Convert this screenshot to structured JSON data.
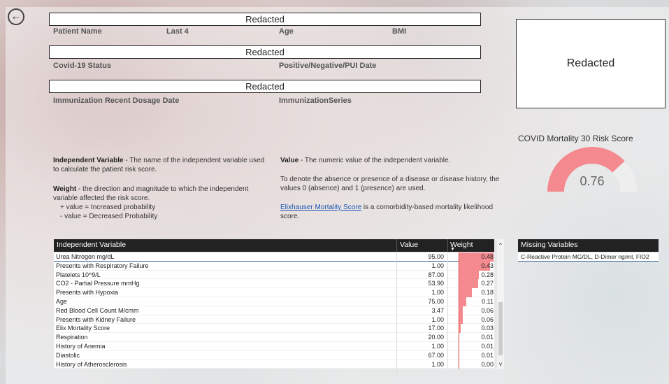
{
  "header": {
    "redacted_1": "Redacted",
    "redacted_2": "Redacted",
    "redacted_3": "Redacted",
    "labels": {
      "patient_name": "Patient Name",
      "last4": "Last 4",
      "age": "Age",
      "bmi": "BMI",
      "covid_status": "Covid-19 Status",
      "positive_date": "Positive/Negative/PUI Date",
      "immunization_date": "Immunization Recent Dosage Date",
      "immunization_series": "ImmunizationSeries"
    }
  },
  "photo": {
    "text": "Redacted"
  },
  "gauge": {
    "title": "COVID Mortality 30 Risk Score",
    "value_label": "0.76",
    "value": 0.76,
    "fill_color": "#f48a8f",
    "track_color": "#eeeeee"
  },
  "legend": {
    "iv_term": "Independent Variable",
    "iv_desc": " - The name of the independent variable used to calculate the patient risk score.",
    "weight_term": "Weight",
    "weight_desc": " - the direction and  magnitude to which the independent variable affected the risk score.",
    "weight_pos": "+ value = Increased probability",
    "weight_neg": "- value = Decreased Probability",
    "value_term": "Value",
    "value_desc": " - The numeric value of the independent  variable.",
    "binary_desc": "To denote the absence or presence of a disease or disease history, the values 0 (absence) and 1 (presence) are used.",
    "elix_link": "Elixhauser Mortality Score",
    "elix_desc": " is a comorbidity-based mortality likelihood score."
  },
  "table": {
    "headers": {
      "name": "Independent Variable",
      "value": "Value",
      "weight": "Weight"
    },
    "rows": [
      {
        "name": "Urea Nitrogen mg/dL",
        "value": "95.00",
        "weight": "0.48",
        "w": 0.48
      },
      {
        "name": "Presents with Respiratory Failure",
        "value": "1.00",
        "weight": "0.43",
        "w": 0.43
      },
      {
        "name": "Platelets 10^9/L",
        "value": "87.00",
        "weight": "0.28",
        "w": 0.28
      },
      {
        "name": "CO2 - Partial Pressure mmHg",
        "value": "53.90",
        "weight": "0.27",
        "w": 0.27
      },
      {
        "name": "Presents with Hypoxia",
        "value": "1.00",
        "weight": "0.18",
        "w": 0.18
      },
      {
        "name": "Age",
        "value": "75.00",
        "weight": "0.11",
        "w": 0.11
      },
      {
        "name": "Red Blood Cell Count M/cmm",
        "value": "3.47",
        "weight": "0.06",
        "w": 0.06
      },
      {
        "name": "Presents with Kidney Failure",
        "value": "1.00",
        "weight": "0.06",
        "w": 0.06
      },
      {
        "name": "Elix Mortality Score",
        "value": "17.00",
        "weight": "0.03",
        "w": 0.03
      },
      {
        "name": "Respiration",
        "value": "20.00",
        "weight": "0.01",
        "w": 0.01
      },
      {
        "name": "History of Anemia",
        "value": "1.00",
        "weight": "0.01",
        "w": 0.01
      },
      {
        "name": "Diastolic",
        "value": "67.00",
        "weight": "0.01",
        "w": 0.01
      },
      {
        "name": "History of Atherosclerosis",
        "value": "1.00",
        "weight": "0.00",
        "w": 0.0
      }
    ],
    "scroll_up": "^",
    "scroll_down": "v",
    "sort_icon": "sort-descending-icon"
  },
  "missing": {
    "header": "Missing Variables",
    "value": "C-Reactive Protein MG/DL, D-Dimer ng/ml, FIO2"
  },
  "icons": {
    "back": "back-arrow-icon"
  },
  "colors": {
    "header_bg": "#222222",
    "bar": "#f48a8f",
    "link": "#1a56b3"
  }
}
